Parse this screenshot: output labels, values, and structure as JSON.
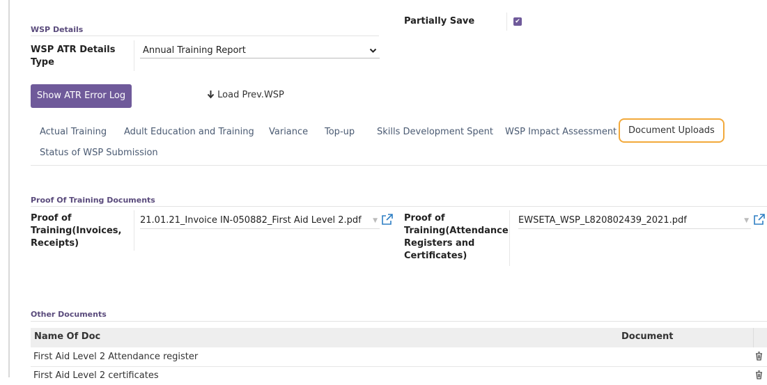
{
  "wsp_section": {
    "title": "WSP Details",
    "details_type_label": "WSP ATR Details Type",
    "details_type_value": "Annual Training Report",
    "partially_save_label": "Partially Save",
    "partially_save_checked": "✔"
  },
  "actions": {
    "error_log_button": "Show ATR Error Log",
    "load_prev_label": "Load Prev.WSP"
  },
  "tabs": [
    "Actual Training",
    "Adult Education and Training",
    "Variance",
    "Top-up",
    "Skills Development Spent",
    "WSP Impact Assessment",
    "Document Uploads",
    "Status of WSP Submission"
  ],
  "active_tab": "Document Uploads",
  "proof_section": {
    "title": "Proof Of Training Documents",
    "invoices_label": "Proof of Training(Invoices, Receipts)",
    "invoices_file": "21.01.21_Invoice IN-050882_First Aid Level 2.pdf",
    "attendance_label": "Proof of Training(Attendance Registers and Certificates)",
    "attendance_file": "EWSETA_WSP_L820802439_2021.pdf"
  },
  "other_docs": {
    "title": "Other Documents",
    "columns": [
      "Name Of Doc",
      "Document"
    ],
    "rows": [
      "First Aid Level 2 Attendance register",
      "First Aid Level 2 certificates"
    ]
  },
  "colors": {
    "accent": "#6f5a9a",
    "active_tab_border": "#f2a93b"
  }
}
